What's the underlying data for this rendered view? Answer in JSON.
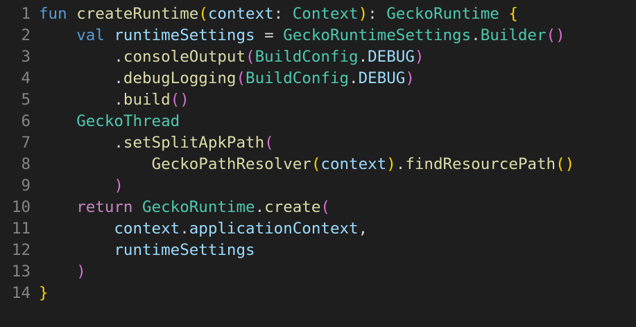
{
  "editor": {
    "language": "kotlin",
    "lines": [
      {
        "number": "1",
        "tokens": [
          {
            "t": "fun",
            "k": "kw"
          },
          {
            "t": " ",
            "k": "punc"
          },
          {
            "t": "createRuntime",
            "k": "fn"
          },
          {
            "t": "(",
            "k": "brace"
          },
          {
            "t": "context",
            "k": "var"
          },
          {
            "t": ": ",
            "k": "punc"
          },
          {
            "t": "Context",
            "k": "type"
          },
          {
            "t": ")",
            "k": "brace"
          },
          {
            "t": ": ",
            "k": "punc"
          },
          {
            "t": "GeckoRuntime",
            "k": "type"
          },
          {
            "t": " ",
            "k": "punc"
          },
          {
            "t": "{",
            "k": "brace"
          }
        ]
      },
      {
        "number": "2",
        "tokens": [
          {
            "t": "    ",
            "k": "punc"
          },
          {
            "t": "val",
            "k": "kw"
          },
          {
            "t": " ",
            "k": "punc"
          },
          {
            "t": "runtimeSettings",
            "k": "var"
          },
          {
            "t": " = ",
            "k": "punc"
          },
          {
            "t": "GeckoRuntimeSettings",
            "k": "type"
          },
          {
            "t": ".",
            "k": "punc"
          },
          {
            "t": "Builder",
            "k": "type"
          },
          {
            "t": "()",
            "k": "paren"
          }
        ]
      },
      {
        "number": "3",
        "tokens": [
          {
            "t": "        .",
            "k": "punc"
          },
          {
            "t": "consoleOutput",
            "k": "fn"
          },
          {
            "t": "(",
            "k": "paren"
          },
          {
            "t": "BuildConfig",
            "k": "type"
          },
          {
            "t": ".",
            "k": "punc"
          },
          {
            "t": "DEBUG",
            "k": "var"
          },
          {
            "t": ")",
            "k": "paren"
          }
        ]
      },
      {
        "number": "4",
        "tokens": [
          {
            "t": "        .",
            "k": "punc"
          },
          {
            "t": "debugLogging",
            "k": "fn"
          },
          {
            "t": "(",
            "k": "paren"
          },
          {
            "t": "BuildConfig",
            "k": "type"
          },
          {
            "t": ".",
            "k": "punc"
          },
          {
            "t": "DEBUG",
            "k": "var"
          },
          {
            "t": ")",
            "k": "paren"
          }
        ]
      },
      {
        "number": "5",
        "tokens": [
          {
            "t": "        .",
            "k": "punc"
          },
          {
            "t": "build",
            "k": "fn"
          },
          {
            "t": "()",
            "k": "paren"
          }
        ]
      },
      {
        "number": "6",
        "tokens": [
          {
            "t": "    ",
            "k": "punc"
          },
          {
            "t": "GeckoThread",
            "k": "type"
          }
        ]
      },
      {
        "number": "7",
        "tokens": [
          {
            "t": "        .",
            "k": "punc"
          },
          {
            "t": "setSplitApkPath",
            "k": "fn"
          },
          {
            "t": "(",
            "k": "paren"
          }
        ]
      },
      {
        "number": "8",
        "tokens": [
          {
            "t": "            ",
            "k": "punc"
          },
          {
            "t": "GeckoPathResolver",
            "k": "fn"
          },
          {
            "t": "(",
            "k": "brace"
          },
          {
            "t": "context",
            "k": "var"
          },
          {
            "t": ")",
            "k": "brace"
          },
          {
            "t": ".",
            "k": "punc"
          },
          {
            "t": "findResourcePath",
            "k": "fn"
          },
          {
            "t": "()",
            "k": "brace"
          }
        ]
      },
      {
        "number": "9",
        "tokens": [
          {
            "t": "        ",
            "k": "punc"
          },
          {
            "t": ")",
            "k": "paren"
          }
        ]
      },
      {
        "number": "10",
        "tokens": [
          {
            "t": "    ",
            "k": "punc"
          },
          {
            "t": "return",
            "k": "kw2"
          },
          {
            "t": " ",
            "k": "punc"
          },
          {
            "t": "GeckoRuntime",
            "k": "type"
          },
          {
            "t": ".",
            "k": "punc"
          },
          {
            "t": "create",
            "k": "fn"
          },
          {
            "t": "(",
            "k": "paren"
          }
        ]
      },
      {
        "number": "11",
        "tokens": [
          {
            "t": "        ",
            "k": "punc"
          },
          {
            "t": "context",
            "k": "var"
          },
          {
            "t": ".",
            "k": "punc"
          },
          {
            "t": "applicationContext",
            "k": "var"
          },
          {
            "t": ",",
            "k": "punc"
          }
        ]
      },
      {
        "number": "12",
        "tokens": [
          {
            "t": "        ",
            "k": "punc"
          },
          {
            "t": "runtimeSettings",
            "k": "var"
          }
        ]
      },
      {
        "number": "13",
        "tokens": [
          {
            "t": "    ",
            "k": "punc"
          },
          {
            "t": ")",
            "k": "paren"
          }
        ]
      },
      {
        "number": "14",
        "tokens": [
          {
            "t": "}",
            "k": "brace"
          }
        ]
      }
    ]
  }
}
